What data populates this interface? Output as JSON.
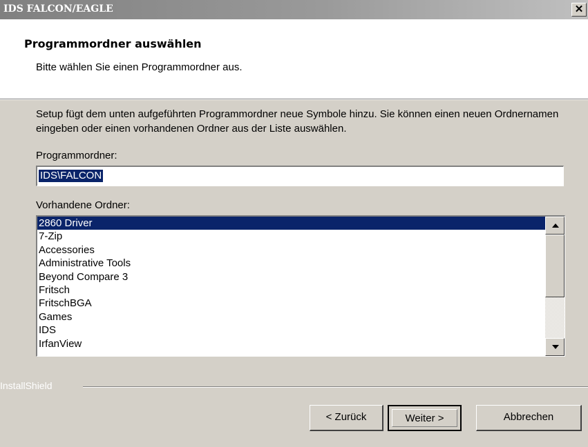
{
  "window": {
    "title": "IDS FALCON/EAGLE",
    "close_glyph": "✕"
  },
  "header": {
    "title": "Programmordner auswählen",
    "subtitle": "Bitte wählen Sie einen Programmordner aus."
  },
  "body": {
    "description": "Setup fügt dem unten aufgeführten Programmordner neue Symbole hinzu. Sie können einen neuen Ordnernamen eingeben oder einen vorhandenen Ordner aus der Liste auswählen.",
    "folder_label": "Programmordner:",
    "folder_value": "IDS\\FALCON",
    "list_label": "Vorhandene Ordner:",
    "folders": [
      "2860 Driver",
      "7-Zip",
      "Accessories",
      "Administrative Tools",
      "Beyond Compare 3",
      "Fritsch",
      "FritschBGA",
      "Games",
      "IDS",
      "IrfanView"
    ],
    "selected_folder": "2860 Driver"
  },
  "footer": {
    "brand": "InstallShield",
    "back_label": "< Zurück",
    "next_label": "Weiter >",
    "cancel_label": "Abbrechen"
  }
}
